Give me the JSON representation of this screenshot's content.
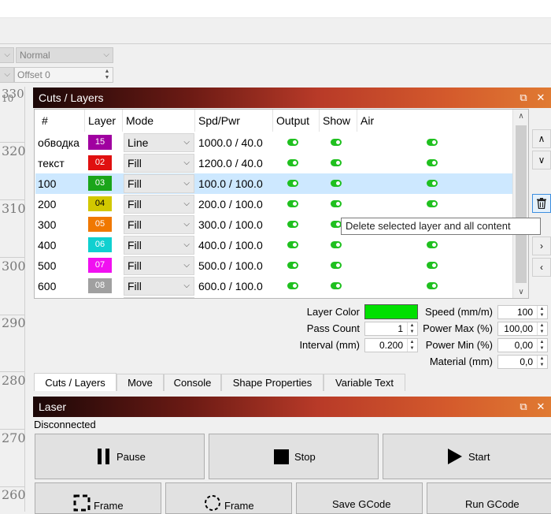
{
  "toolbar": {
    "blend_mode": "Normal",
    "offset_label": "Offset",
    "offset_value": "0"
  },
  "ruler": {
    "labels": [
      "330",
      "10",
      "320",
      "310",
      "300",
      "290",
      "280",
      "270",
      "260"
    ]
  },
  "cuts_panel": {
    "title": "Cuts / Layers",
    "float_icon": "restore-icon",
    "close_icon": "close-icon",
    "headers": [
      "#",
      "Layer",
      "Mode",
      "Spd/Pwr",
      "Output",
      "Show",
      "Air"
    ],
    "rows": [
      {
        "name": "обводка",
        "layer": "15",
        "color": "#a000a0",
        "mode": "Line",
        "spdpwr": "1000.0 / 40.0",
        "output": true,
        "show": true,
        "air": true
      },
      {
        "name": "текст",
        "layer": "02",
        "color": "#e01010",
        "mode": "Fill",
        "spdpwr": "1200.0 / 40.0",
        "output": true,
        "show": true,
        "air": true
      },
      {
        "name": "100",
        "layer": "03",
        "color": "#1aa51a",
        "mode": "Fill",
        "spdpwr": "100.0 / 100.0",
        "output": true,
        "show": true,
        "air": true
      },
      {
        "name": "200",
        "layer": "04",
        "color": "#d2c800",
        "mode": "Fill",
        "spdpwr": "200.0 / 100.0",
        "output": true,
        "show": true,
        "air": true
      },
      {
        "name": "300",
        "layer": "05",
        "color": "#f07800",
        "mode": "Fill",
        "spdpwr": "300.0 / 100.0",
        "output": true,
        "show": true,
        "air": true
      },
      {
        "name": "400",
        "layer": "06",
        "color": "#10d0d0",
        "mode": "Fill",
        "spdpwr": "400.0 / 100.0",
        "output": true,
        "show": true,
        "air": true
      },
      {
        "name": "500",
        "layer": "07",
        "color": "#f010f0",
        "mode": "Fill",
        "spdpwr": "500.0 / 100.0",
        "output": true,
        "show": true,
        "air": true
      },
      {
        "name": "600",
        "layer": "08",
        "color": "#a0a0a0",
        "mode": "Fill",
        "spdpwr": "600.0 / 100.0",
        "output": true,
        "show": true,
        "air": true
      }
    ],
    "selected_row": 2
  },
  "side_buttons": {
    "up_icon": "chevron-up-icon",
    "down_icon": "chevron-down-icon",
    "delete_icon": "trash-icon",
    "right_icon": "chevron-right-icon",
    "left_icon": "chevron-left-icon"
  },
  "tooltip": "Delete selected layer and all content",
  "props": {
    "layer_color_label": "Layer Color",
    "layer_color": "#00e000",
    "pass_count_label": "Pass Count",
    "pass_count": "1",
    "interval_label": "Interval (mm)",
    "interval": "0.200",
    "speed_label": "Speed (mm/m)",
    "speed": "100",
    "power_max_label": "Power Max (%)",
    "power_max": "100,00",
    "power_min_label": "Power Min (%)",
    "power_min": "0,00",
    "material_label": "Material (mm)",
    "material": "0,0"
  },
  "tabs": [
    "Cuts / Layers",
    "Move",
    "Console",
    "Shape Properties",
    "Variable Text"
  ],
  "laser_panel": {
    "title": "Laser",
    "status": "Disconnected",
    "pause": "Pause",
    "stop": "Stop",
    "start": "Start",
    "frame1": "Frame",
    "frame2": "Frame",
    "save_gcode": "Save GCode",
    "run_gcode": "Run GCode"
  }
}
